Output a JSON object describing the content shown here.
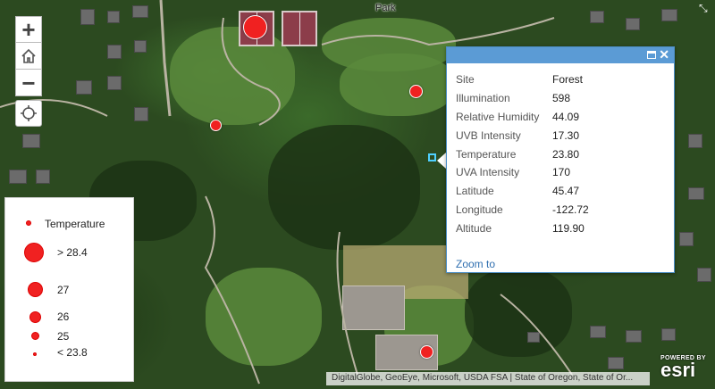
{
  "map": {
    "park_label": "Park",
    "attribution": "DigitalGlobe, GeoEye, Microsoft, USDA FSA | State of Oregon, State of Or...",
    "powered_by": "POWERED BY",
    "logo_text": "esri"
  },
  "nav": {
    "zoom_in": "+",
    "zoom_out": "−"
  },
  "legend": {
    "title": "Temperature",
    "classes": [
      {
        "label": "> 28.4"
      },
      {
        "label": "27"
      },
      {
        "label": "26"
      },
      {
        "label": "25"
      },
      {
        "label": "< 23.8"
      }
    ]
  },
  "popup": {
    "rows": [
      {
        "key": "Site",
        "value": "Forest"
      },
      {
        "key": "Illumination",
        "value": "598"
      },
      {
        "key": "Relative Humidity",
        "value": "44.09"
      },
      {
        "key": "UVB Intensity",
        "value": "17.30"
      },
      {
        "key": "Temperature",
        "value": "23.80"
      },
      {
        "key": "UVA Intensity",
        "value": "170"
      },
      {
        "key": "Latitude",
        "value": "45.47"
      },
      {
        "key": "Longitude",
        "value": "-122.72"
      },
      {
        "key": "Altitude",
        "value": "119.90"
      }
    ],
    "zoom_link": "Zoom to"
  },
  "colors": {
    "point": "#f02121",
    "popup_header": "#5b9bd5",
    "link": "#2f6fb0"
  }
}
